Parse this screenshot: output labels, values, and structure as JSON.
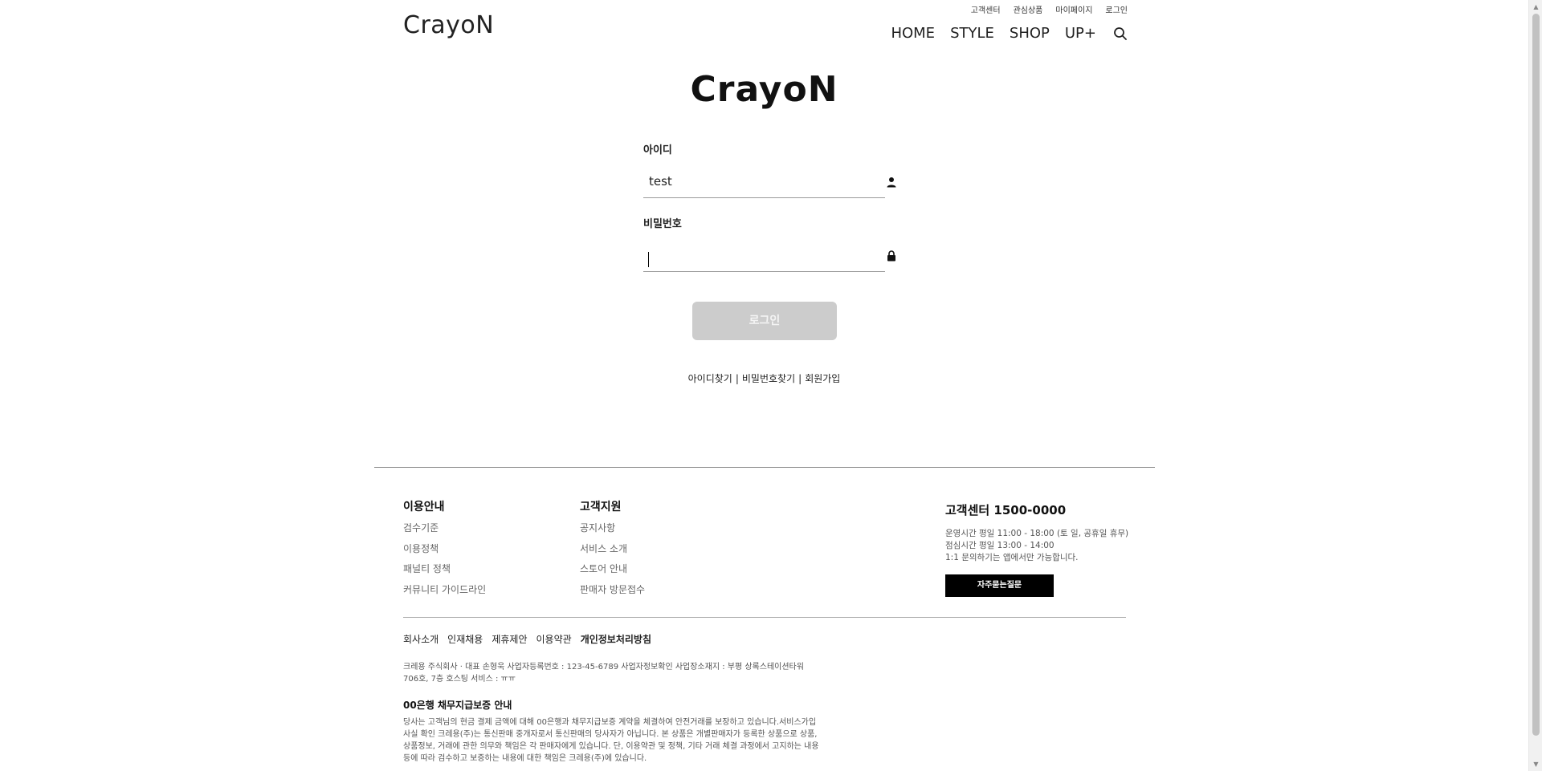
{
  "header": {
    "logo": "CrayoN",
    "util_links": [
      "고객센터",
      "관심상품",
      "마이페이지",
      "로그인"
    ],
    "nav": [
      "HOME",
      "STYLE",
      "SHOP",
      "UP+"
    ],
    "search_icon": "search-icon"
  },
  "login": {
    "logo": "CrayoN",
    "id_label": "아이디",
    "id_value": "test",
    "id_icon": "user-icon",
    "pw_label": "비밀번호",
    "pw_value": "",
    "pw_icon": "lock-icon",
    "button": "로그인",
    "links": [
      "아이디찾기",
      "비밀번호찾기",
      "회원가입"
    ]
  },
  "footer": {
    "guide": {
      "title": "이용안내",
      "items": [
        "검수기준",
        "이용정책",
        "패널티 정책",
        "커뮤니티 가이드라인"
      ]
    },
    "support": {
      "title": "고객지원",
      "items": [
        "공지사항",
        "서비스 소개",
        "스토어 안내",
        "판매자 방문접수"
      ]
    },
    "cs": {
      "title": "고객센터 1500-0000",
      "lines": [
        "운영시간 평일 11:00 - 18:00 (토 일, 공휴일 휴무)",
        "점심시간 평일 13:00 - 14:00",
        "1:1 문의하기는 앱에서만 가능합니다."
      ],
      "faq_button": "자주묻는질문"
    },
    "policy_links": [
      "회사소개",
      "인재채용",
      "제휴제안",
      "이용약관",
      "개인정보처리방침"
    ],
    "business_info": "크레용 주식회사 · 대표 손형욱    사업자등록번호 : 123-45-6789    사업자정보확인    사업장소재지 : 부평 상록스테이션타워 706호, 7층    호스팅 서비스 : ㅠㅠ",
    "bank_title": "00은행 채무지급보증 안내",
    "bank_desc": "당사는 고객님의 현금 결제 금액에 대해 00은행과 채무지급보증 계약을 체결하여 안전거래를 보장하고 있습니다.서비스가입 사실 확인 크레용(주)는 통신판매 중개자로서 통신판매의 당사자가 아닙니다. 본 상품은 개별판매자가 등록한 상품으로 상품, 상품정보, 거래에 관한 의무와 책임은 각 판매자에게 있습니다. 단, 이용약관 및 정책, 기타 거래 체결 과정에서 고지하는 내용 등에 따라 검수하고 보증하는 내용에 대한 책임은 크레용(주)에 있습니다."
  }
}
